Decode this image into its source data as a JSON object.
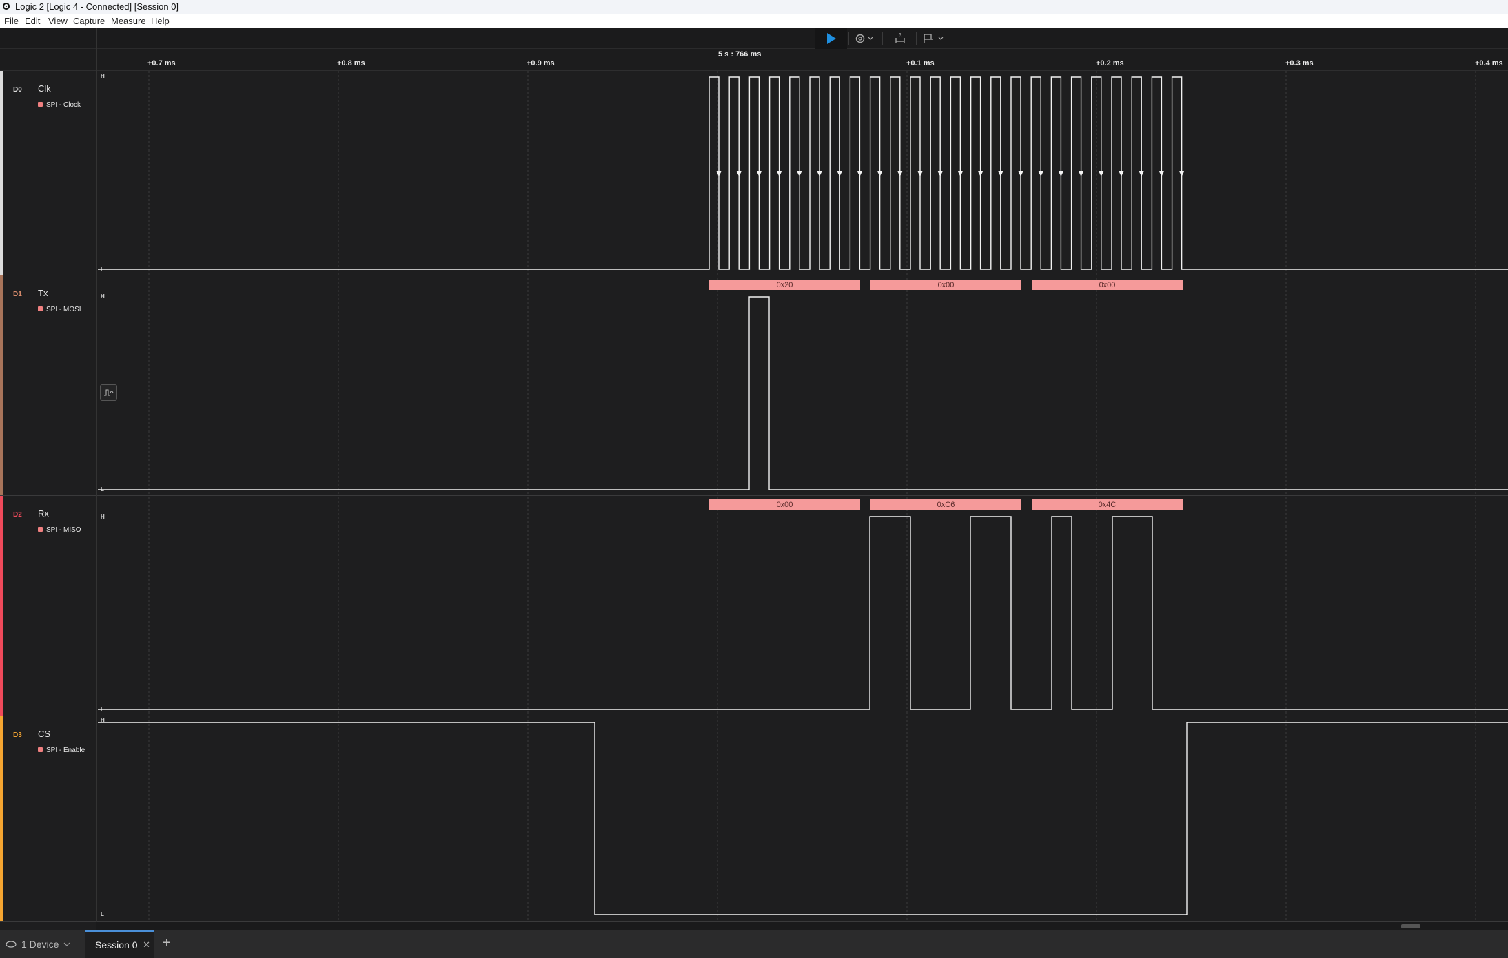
{
  "window": {
    "title": "Logic 2 [Logic 4 - Connected] [Session 0]"
  },
  "menu": [
    "File",
    "Edit",
    "View",
    "Capture",
    "Measure",
    "Help"
  ],
  "toolbar": {
    "play_icon": "play-icon",
    "device_settings_icon": "device-settings-icon",
    "measure_icon": "timing-marker-icon",
    "marker_icon": "flag-icon",
    "marker_count": "3",
    "accent_color": "#1f8fe0"
  },
  "timeline": {
    "cursor_time": "5 s : 766 ms",
    "ticks": [
      "+0.7 ms",
      "+0.8 ms",
      "+0.9 ms",
      "+0.1 ms",
      "+0.2 ms",
      "+0.3 ms",
      "+0.4 ms"
    ]
  },
  "level_labels": {
    "high": "H",
    "low": "L"
  },
  "channels": [
    {
      "id": "D0",
      "name": "Clk",
      "analyzer": "SPI - Clock",
      "color": "#dcdcdc"
    },
    {
      "id": "D1",
      "name": "Tx",
      "analyzer": "SPI - MOSI",
      "color": "#a8745a",
      "frames": [
        "0x20",
        "0x00",
        "0x00"
      ]
    },
    {
      "id": "D2",
      "name": "Rx",
      "analyzer": "SPI - MISO",
      "color": "#f04a5b",
      "frames": [
        "0x00",
        "0xC6",
        "0x4C"
      ]
    },
    {
      "id": "D3",
      "name": "CS",
      "analyzer": "SPI - Enable",
      "color": "#f5a531"
    }
  ],
  "frame_color": "#f59a9a",
  "tabs": {
    "device": "1 Device",
    "session": "Session 0",
    "close_icon": "close-icon",
    "add_icon": "plus-icon"
  }
}
